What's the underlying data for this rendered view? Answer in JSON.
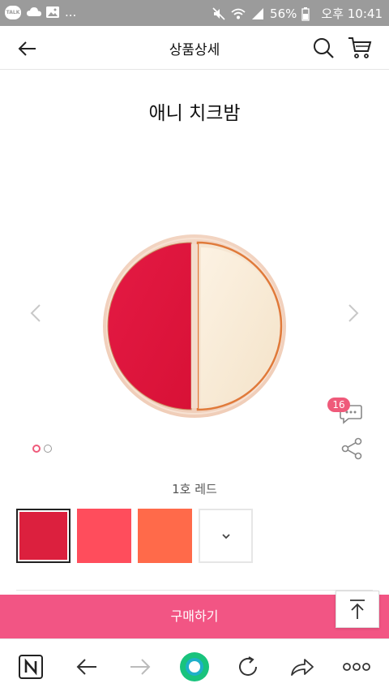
{
  "statusbar": {
    "talk_label": "TALK",
    "more": "...",
    "battery": "56%",
    "time": "오후 10:41"
  },
  "header": {
    "title": "상품상세"
  },
  "product": {
    "name": "애니 치크밤",
    "review_count": "16",
    "selected_color_name": "1호 레드",
    "swatches": [
      "#dc203e",
      "#ff4d5c",
      "#ff6a4a"
    ],
    "image_colors": {
      "left_half": "#e0153c",
      "right_half": "#f8ead9",
      "frame": "#f4d8c7",
      "rim": "#e28a4f"
    },
    "carousel": {
      "current": 1,
      "total": 2
    }
  },
  "actions": {
    "buy_label": "구매하기"
  },
  "colors": {
    "accent": "#f25584",
    "badge": "#ef5a7a",
    "statusbar": "#9b9b9b",
    "browser_home": "#19c37d"
  }
}
